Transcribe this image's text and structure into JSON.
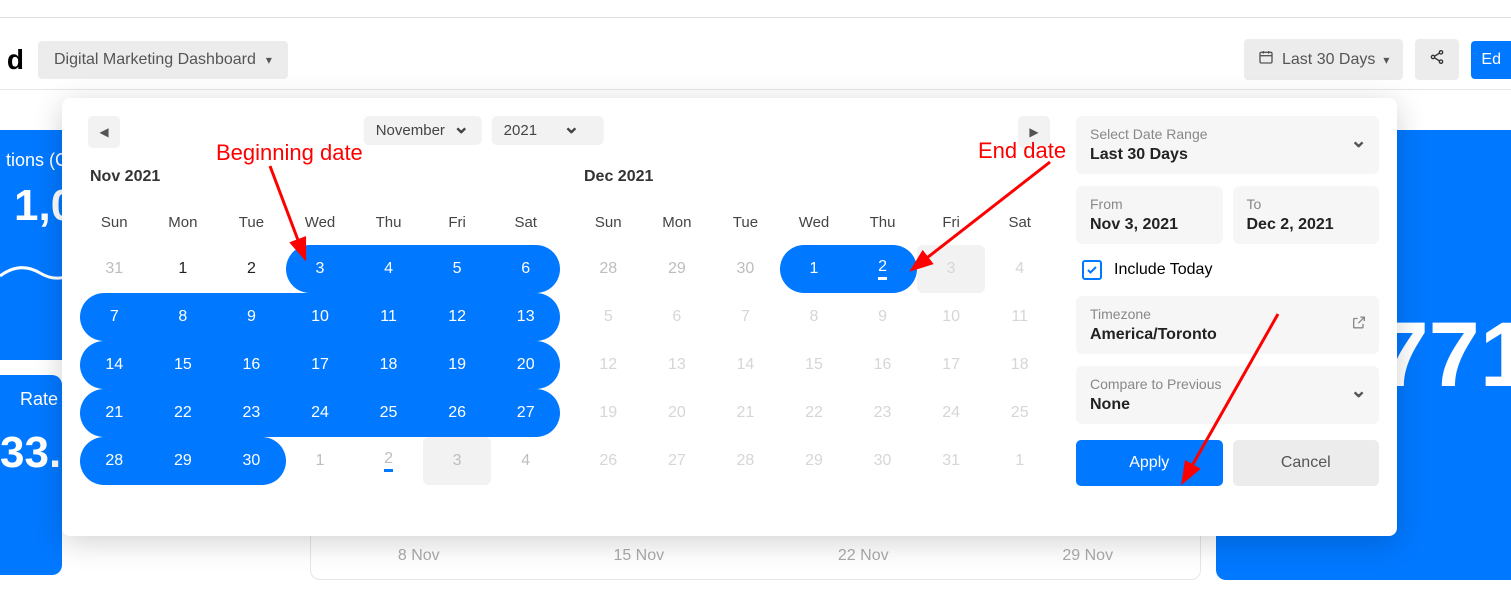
{
  "header": {
    "page_letter": "d",
    "dashboard_dropdown": "Digital Marketing Dashboard",
    "date_btn": "Last 30 Days",
    "edit_btn": "Ed"
  },
  "bg": {
    "left_tile_title": "tions (C",
    "left_tile_num": "1,0",
    "left_tile2_title": "Rate",
    "left_tile2_num": "33.",
    "right_tile_num": "771",
    "xticks": [
      "8 Nov",
      "15 Nov",
      "22 Nov",
      "29 Nov"
    ]
  },
  "annotations": {
    "begin": "Beginning date",
    "end": "End date"
  },
  "datepicker": {
    "month_dd": "November",
    "year_dd": "2021",
    "cal1": {
      "title": "Nov 2021"
    },
    "cal2": {
      "title": "Dec 2021"
    },
    "dow": [
      "Sun",
      "Mon",
      "Tue",
      "Wed",
      "Thu",
      "Fri",
      "Sat"
    ],
    "nov": {
      "lead": [
        "31"
      ],
      "days": [
        "1",
        "2",
        "3",
        "4",
        "5",
        "6",
        "7",
        "8",
        "9",
        "10",
        "11",
        "12",
        "13",
        "14",
        "15",
        "16",
        "17",
        "18",
        "19",
        "20",
        "21",
        "22",
        "23",
        "24",
        "25",
        "26",
        "27",
        "28",
        "29",
        "30"
      ],
      "trail": [
        "1",
        "2",
        "3",
        "4"
      ]
    },
    "dec": {
      "lead": [
        "28",
        "29",
        "30"
      ],
      "days": [
        "1",
        "2",
        "3",
        "4",
        "5",
        "6",
        "7",
        "8",
        "9",
        "10",
        "11",
        "12",
        "13",
        "14",
        "15",
        "16",
        "17",
        "18",
        "19",
        "20",
        "21",
        "22",
        "23",
        "24",
        "25",
        "26",
        "27",
        "28",
        "29",
        "30",
        "31"
      ],
      "trail": [
        "1"
      ]
    },
    "panel": {
      "range_label": "Select Date Range",
      "range_val": "Last 30 Days",
      "from_label": "From",
      "from_val": "Nov 3, 2021",
      "to_label": "To",
      "to_val": "Dec 2, 2021",
      "include_today": "Include Today",
      "tz_label": "Timezone",
      "tz_val": "America/Toronto",
      "compare_label": "Compare to Previous",
      "compare_val": "None",
      "apply": "Apply",
      "cancel": "Cancel"
    }
  }
}
